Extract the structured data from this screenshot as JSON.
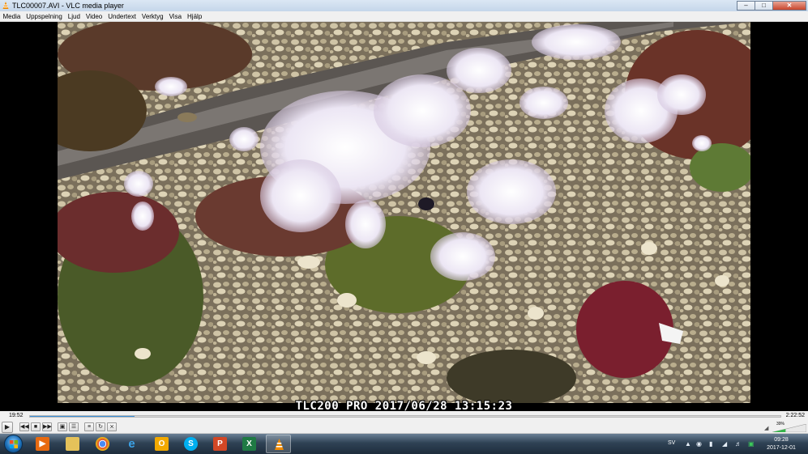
{
  "window": {
    "title": "TLC00007.AVI - VLC media player",
    "minimize_icon": "minimize-icon",
    "maximize_icon": "maximize-icon",
    "close_icon": "close-icon"
  },
  "menu": {
    "items": [
      "Media",
      "Uppspelning",
      "Ljud",
      "Video",
      "Undertext",
      "Verktyg",
      "Visa",
      "Hjälp"
    ]
  },
  "video": {
    "osd_text": "TLC200 PRO 2017/06/28 13:15:23"
  },
  "seekbar": {
    "elapsed": "19:52",
    "total": "2:22:52",
    "progress_fraction": 0.139
  },
  "controls": {
    "volume_label": "39%",
    "volume_fraction": 0.39,
    "icons": [
      "play-icon",
      "previous-icon",
      "stop-icon",
      "next-icon",
      "fullscreen-icon",
      "extended-settings-icon",
      "playlist-icon",
      "loop-icon",
      "shuffle-icon"
    ]
  },
  "taskbar": {
    "apps": [
      "start-icon",
      "media-player-icon",
      "folder-icon",
      "chrome-icon",
      "internet-explorer-icon",
      "outlook-icon",
      "skype-icon",
      "powerpoint-icon",
      "excel-icon",
      "vlc-icon"
    ],
    "language": "SV",
    "time": "09:28",
    "date": "2017-12-01"
  },
  "colors": {
    "accent": "#3a8fd8",
    "close_button": "#c8462d",
    "taskbar": "#2f4255"
  }
}
